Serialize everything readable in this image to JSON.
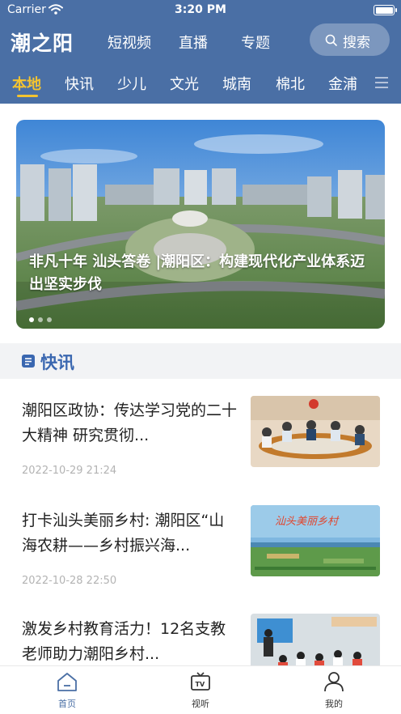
{
  "status_bar": {
    "carrier": "Carrier",
    "time": "3:20 PM"
  },
  "app": {
    "logo": "潮之阳",
    "top_nav": [
      "短视频",
      "直播",
      "专题"
    ],
    "search_label": "搜索"
  },
  "channels": [
    "本地",
    "快讯",
    "少儿",
    "文光",
    "城南",
    "棉北",
    "金浦"
  ],
  "banner": {
    "caption": "非凡十年 汕头答卷 |潮阳区：构建现代化产业体系迈出坚实步伐"
  },
  "section": {
    "title": "快讯"
  },
  "news": [
    {
      "title": "潮阳区政协：传达学习党的二十大精神 研究贯彻...",
      "date": "2022-10-29 21:24"
    },
    {
      "title": "打卡汕头美丽乡村: 潮阳区“山海农耕——乡村振兴海...",
      "date": "2022-10-28 22:50",
      "thumb_text": "汕头美丽乡村"
    },
    {
      "title": "激发乡村教育活力！12名支教老师助力潮阳乡村...",
      "date": ""
    }
  ],
  "tabbar": [
    "首页",
    "视听",
    "我的"
  ],
  "colors": {
    "header": "#4a6fa5",
    "accent": "#f4c430",
    "section_title": "#3a67b0"
  },
  "icons": [
    "wifi-icon",
    "battery-icon",
    "search-icon",
    "menu-icon",
    "news-icon",
    "home-icon",
    "tv-icon",
    "user-icon"
  ]
}
